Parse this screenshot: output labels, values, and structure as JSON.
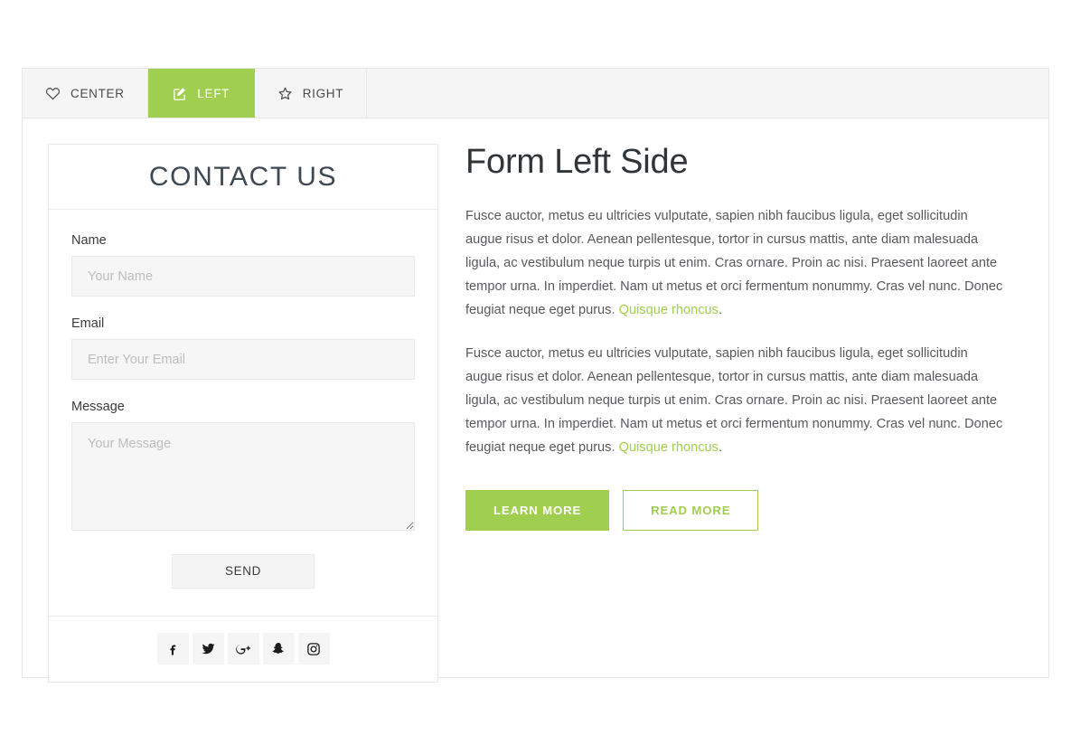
{
  "colors": {
    "accent": "#a0ce4e",
    "tabbar_bg": "#f5f5f5",
    "panel_border": "#e7e7e7",
    "input_bg": "#f6f6f6",
    "text": "#57595c",
    "heading": "#30353a"
  },
  "tabs": [
    {
      "label": "CENTER",
      "icon": "heart-icon",
      "active": false
    },
    {
      "label": "LEFT",
      "icon": "edit-pencil-icon",
      "active": true
    },
    {
      "label": "RIGHT",
      "icon": "star-icon",
      "active": false
    }
  ],
  "contact_card": {
    "title": "CONTACT US",
    "fields": [
      {
        "label": "Name",
        "placeholder": "Your Name",
        "value": "",
        "type": "text",
        "name": "name"
      },
      {
        "label": "Email",
        "placeholder": "Enter Your Email",
        "value": "",
        "type": "text",
        "name": "email"
      },
      {
        "label": "Message",
        "placeholder": "Your Message",
        "value": "",
        "type": "textarea",
        "name": "message"
      }
    ],
    "send_label": "SEND",
    "social": [
      {
        "name": "facebook-icon",
        "label": "Facebook"
      },
      {
        "name": "twitter-icon",
        "label": "Twitter"
      },
      {
        "name": "google-plus-icon",
        "label": "Google Plus"
      },
      {
        "name": "snapchat-icon",
        "label": "Snapchat"
      },
      {
        "name": "instagram-icon",
        "label": "Instagram"
      }
    ]
  },
  "main": {
    "heading": "Form Left Side",
    "paragraph_1": "Fusce auctor, metus eu ultricies vulputate, sapien nibh faucibus ligula, eget sollicitudin augue risus et dolor. Aenean pellentesque, tortor in cursus mattis, ante diam malesuada ligula, ac vestibulum neque turpis ut enim. Cras ornare. Proin ac nisi. Praesent laoreet ante tempor urna. In imperdiet. Nam ut metus et orci fermentum nonummy. Cras vel nunc. Donec feugiat neque eget purus.",
    "link_1": "Quisque rhoncus",
    "link_1_suffix": ".",
    "paragraph_2": "Fusce auctor, metus eu ultricies vulputate, sapien nibh faucibus ligula, eget sollicitudin augue risus et dolor. Aenean pellentesque, tortor in cursus mattis, ante diam malesuada ligula, ac vestibulum neque turpis ut enim. Cras ornare. Proin ac nisi. Praesent laoreet ante tempor urna. In imperdiet. Nam ut metus et orci fermentum nonummy. Cras vel nunc. Donec feugiat neque eget purus.",
    "link_2": "Quisque rhoncus",
    "link_2_suffix": ".",
    "primary_button": "LEARN MORE",
    "secondary_button": "READ MORE"
  }
}
